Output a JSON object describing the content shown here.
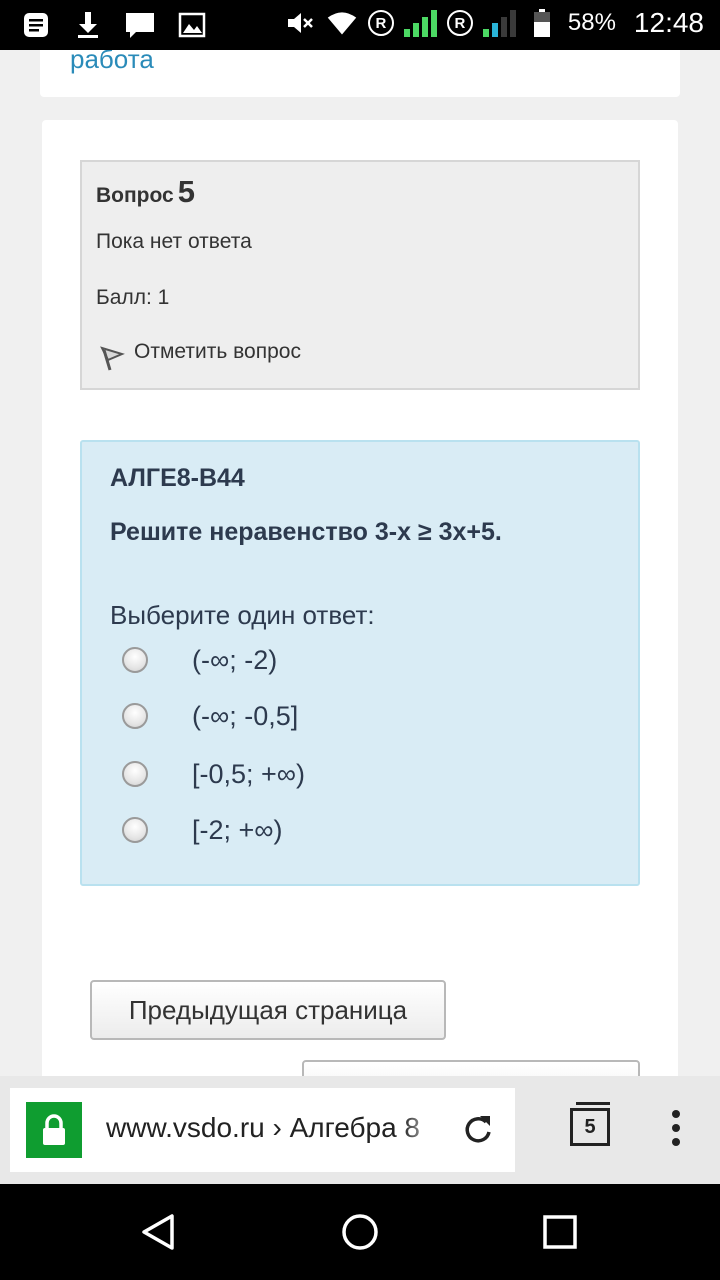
{
  "status_bar": {
    "icons": [
      "notes-icon",
      "download-icon",
      "message-icon",
      "image-icon",
      "mute-icon",
      "wifi-icon",
      "signal-roaming-icon",
      "signal-roaming-icon-2",
      "battery-icon"
    ],
    "battery": "58%",
    "time": "12:48",
    "roaming_badge": "R"
  },
  "page": {
    "top_link": "работа",
    "question_info": {
      "label": "Вопрос",
      "number": "5",
      "status": "Пока нет ответа",
      "grade": "Балл: 1",
      "flag_label": "Отметить вопрос"
    },
    "question": {
      "code": "АЛГЕ8-В44",
      "prompt": "Решите неравенство 3-x ≥ 3x+5.",
      "choose_label": "Выберите один ответ:",
      "options": [
        {
          "label": "(-∞; -2)",
          "selected": false
        },
        {
          "label": "(-∞; -0,5]",
          "selected": false
        },
        {
          "label": "[-0,5; +∞)",
          "selected": false
        },
        {
          "label": "[-2; +∞)",
          "selected": false
        }
      ]
    },
    "prev_button": "Предыдущая страница",
    "next_button": ""
  },
  "browser": {
    "url": "www.vsdo.ru › Алгебра 8",
    "tab_count": "5",
    "lock_color": "#0f9d30"
  },
  "colors": {
    "link": "#2a8bb9",
    "question_bg": "#d9ecf5",
    "question_border": "#b9e1ef",
    "text_dark": "#2d3a4e"
  }
}
